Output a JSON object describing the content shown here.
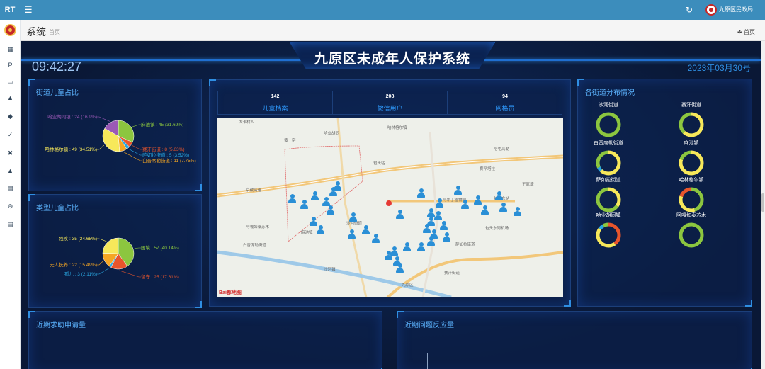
{
  "topbar": {
    "brand": "RT",
    "menu_icon": "hamburger-icon",
    "refresh_icon": "refresh-icon",
    "user": "九原区民政局"
  },
  "sidebar": {
    "icons": [
      "bar-chart-icon",
      "parking-icon",
      "id-card-icon",
      "hierarchy-icon",
      "tag-icon",
      "bolt-icon",
      "tools-icon",
      "flask-icon",
      "table-icon",
      "circle-dash-icon",
      "list-icon"
    ]
  },
  "page": {
    "title": "系统",
    "subtitle": "首页",
    "home_icon": "dashboard-icon",
    "home": "首页"
  },
  "dashboard": {
    "title": "九原区未成年人保护系统",
    "clock": "09:42:27",
    "date": "2023年03月30号",
    "street_ratio": {
      "title": "街道儿童占比"
    },
    "type_ratio": {
      "title": "类型儿童占比"
    },
    "stats": [
      {
        "value": "142",
        "label": "儿童档案"
      },
      {
        "value": "208",
        "label": "微信用户"
      },
      {
        "value": "94",
        "label": "网格员"
      }
    ],
    "distribution": {
      "title": "各街道分布情况",
      "districts": [
        "沙河街道",
        "赛汗街道",
        "白音席勒街道",
        "麻池镇",
        "萨如拉街道",
        "哈林格尔镇",
        "哈业胡同镇",
        "阿嘎如泰苏木"
      ]
    },
    "bottom_left": {
      "title": "近期求助申请量"
    },
    "bottom_right": {
      "title": "近期问题反应量"
    },
    "map": {
      "logo": "Bai都地图",
      "places": [
        "大卡村四",
        "黄土窑",
        "哈业胡同",
        "阿嘎如泰苏木",
        "哈林格尔镇",
        "麻池镇",
        "萨如拉街道",
        "赛汗街道",
        "白音席勒街道",
        "沙河街道",
        "包头东河机场",
        "阿尔丁植物园",
        "赛罕塔拉",
        "包头站",
        "京藏高速",
        "沙河镇",
        "包头东站",
        "九原区",
        "哈屯高勒",
        "王家壕"
      ]
    }
  },
  "chart_data": [
    {
      "type": "pie",
      "name": "街道儿童占比",
      "slices": [
        {
          "label": "麻池镇",
          "value": 45,
          "percent": "31.69%",
          "color": "#8cc63f"
        },
        {
          "label": "赛汗街道",
          "value": 8,
          "percent": "5.63%",
          "color": "#e8552c"
        },
        {
          "label": "萨如拉街道",
          "value": 5,
          "percent": "3.52%",
          "color": "#29a7e1"
        },
        {
          "label": "白音席勒街道",
          "value": 11,
          "percent": "7.75%",
          "color": "#f5a623"
        },
        {
          "label": "哈林格尔镇",
          "value": 49,
          "percent": "34.51%",
          "color": "#f7e85a"
        },
        {
          "label": "哈业胡同镇",
          "value": 24,
          "percent": "16.9%",
          "color": "#9b59b6"
        }
      ]
    },
    {
      "type": "pie",
      "name": "类型儿童占比",
      "slices": [
        {
          "label": "困境",
          "value": 57,
          "percent": "40.14%",
          "color": "#8cc63f"
        },
        {
          "label": "留守",
          "value": 25,
          "percent": "17.61%",
          "color": "#e8552c"
        },
        {
          "label": "孤儿",
          "value": 3,
          "percent": "2.11%",
          "color": "#29a7e1"
        },
        {
          "label": "无人抚养",
          "value": 22,
          "percent": "15.49%",
          "color": "#f5a623"
        },
        {
          "label": "残疾",
          "value": 35,
          "percent": "24.65%",
          "color": "#f7e85a"
        }
      ]
    },
    {
      "type": "donut",
      "name": "各街道分布情况",
      "rings": [
        {
          "segments": [
            {
              "value": 1,
              "color": "#8cc63f"
            }
          ]
        },
        {
          "segments": [
            {
              "value": 0.62,
              "color": "#f7e85a"
            },
            {
              "value": 0.38,
              "color": "#8cc63f"
            }
          ]
        },
        {
          "segments": [
            {
              "value": 0.62,
              "color": "#f7e85a"
            },
            {
              "value": 0.06,
              "color": "#29a7e1"
            },
            {
              "value": 0.32,
              "color": "#8cc63f"
            }
          ]
        },
        {
          "segments": [
            {
              "value": 0.8,
              "color": "#f7e85a"
            },
            {
              "value": 0.2,
              "color": "#8cc63f"
            }
          ]
        },
        {
          "segments": [
            {
              "value": 0.35,
              "color": "#f7e85a"
            },
            {
              "value": 0.65,
              "color": "#8cc63f"
            }
          ]
        },
        {
          "segments": [
            {
              "value": 0.45,
              "color": "#8cc63f"
            },
            {
              "value": 0.35,
              "color": "#f7e85a"
            },
            {
              "value": 0.2,
              "color": "#e8552c"
            }
          ]
        },
        {
          "segments": [
            {
              "value": 0.4,
              "color": "#e8552c"
            },
            {
              "value": 0.45,
              "color": "#f7e85a"
            },
            {
              "value": 0.07,
              "color": "#29a7e1"
            },
            {
              "value": 0.08,
              "color": "#8cc63f"
            }
          ]
        },
        {
          "segments": [
            {
              "value": 1,
              "color": "#8cc63f"
            }
          ]
        }
      ]
    }
  ]
}
